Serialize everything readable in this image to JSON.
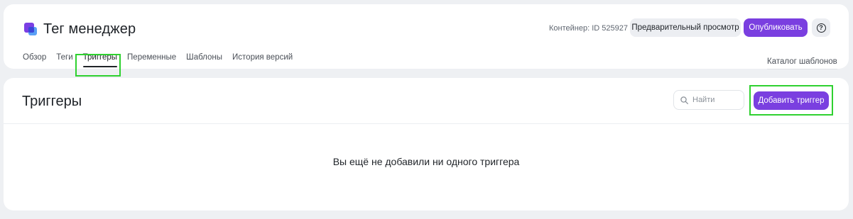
{
  "header": {
    "app_title": "Тег менеджер",
    "container_id": "Контейнер: ID 525927",
    "preview_label": "Предварительный просмотр",
    "publish_label": "Опубликовать",
    "help_label": "?"
  },
  "tabs": [
    {
      "label": "Обзор"
    },
    {
      "label": "Теги"
    },
    {
      "label": "Триггеры",
      "active": true
    },
    {
      "label": "Переменные"
    },
    {
      "label": "Шаблоны"
    },
    {
      "label": "История версий"
    }
  ],
  "catalog_label": "Каталог шаблонов",
  "main": {
    "title": "Триггеры",
    "search_placeholder": "Найти",
    "add_label": "Добавить триггер",
    "empty_message": "Вы ещё не добавили ни одного триггера"
  },
  "colors": {
    "accent": "#7a3fe0",
    "highlight": "#2fd130"
  }
}
